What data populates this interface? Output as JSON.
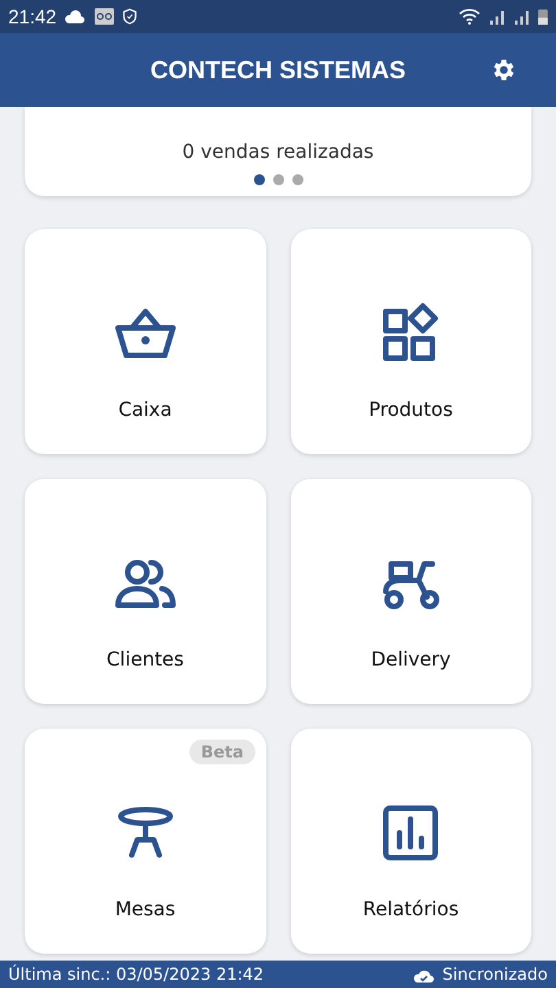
{
  "status_bar": {
    "time": "21:42"
  },
  "app_bar": {
    "title": "CONTECH SISTEMAS"
  },
  "sales_card": {
    "text": "0 vendas realizadas",
    "dots": [
      {
        "selected": true
      },
      {
        "selected": false
      },
      {
        "selected": false
      }
    ]
  },
  "tiles": [
    {
      "label": "Caixa"
    },
    {
      "label": "Produtos"
    },
    {
      "label": "Clientes"
    },
    {
      "label": "Delivery"
    },
    {
      "label": "Mesas",
      "badge": "Beta"
    },
    {
      "label": "Relatórios"
    }
  ],
  "footer": {
    "last_sync": "Última sinc.: 03/05/2023 21:42",
    "sync_status": "Sincronizado"
  }
}
